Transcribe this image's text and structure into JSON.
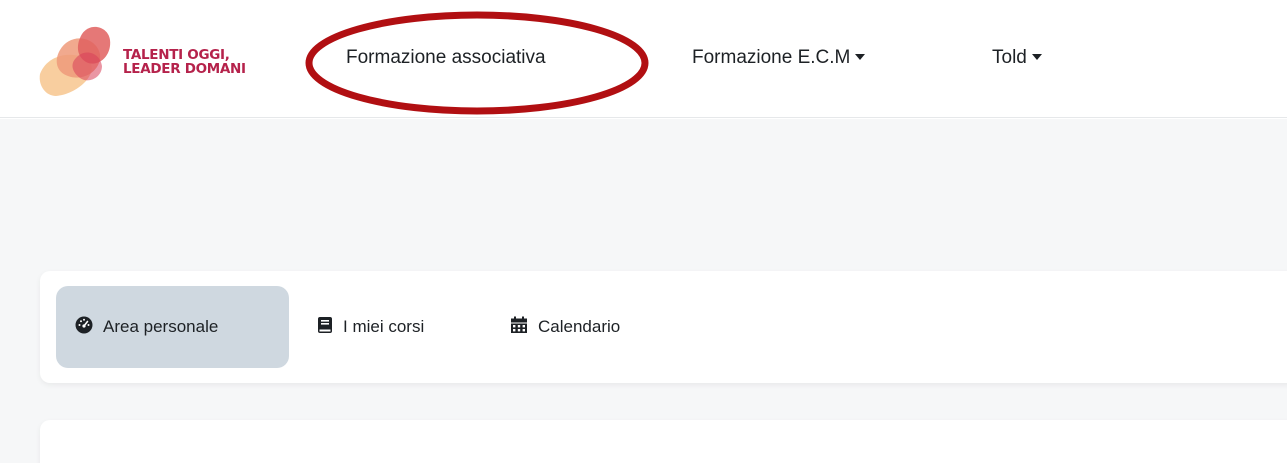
{
  "brand": {
    "line1": "TALENTI OGGI,",
    "line2": "LEADER DOMANI",
    "color": "#b5224b"
  },
  "navbar": {
    "items": [
      {
        "label": "Formazione associativa",
        "dropdown": false
      },
      {
        "label": "Formazione E.C.M",
        "dropdown": true
      },
      {
        "label": "Told",
        "dropdown": true
      }
    ],
    "annotation_color": "#b10f12"
  },
  "secondary_nav": {
    "items": [
      {
        "label": "Area personale",
        "icon": "dashboard-icon",
        "active": true
      },
      {
        "label": "I miei corsi",
        "icon": "book-icon",
        "active": false
      },
      {
        "label": "Calendario",
        "icon": "calendar-icon",
        "active": false
      }
    ],
    "active_bg": "#cfd8e0"
  }
}
